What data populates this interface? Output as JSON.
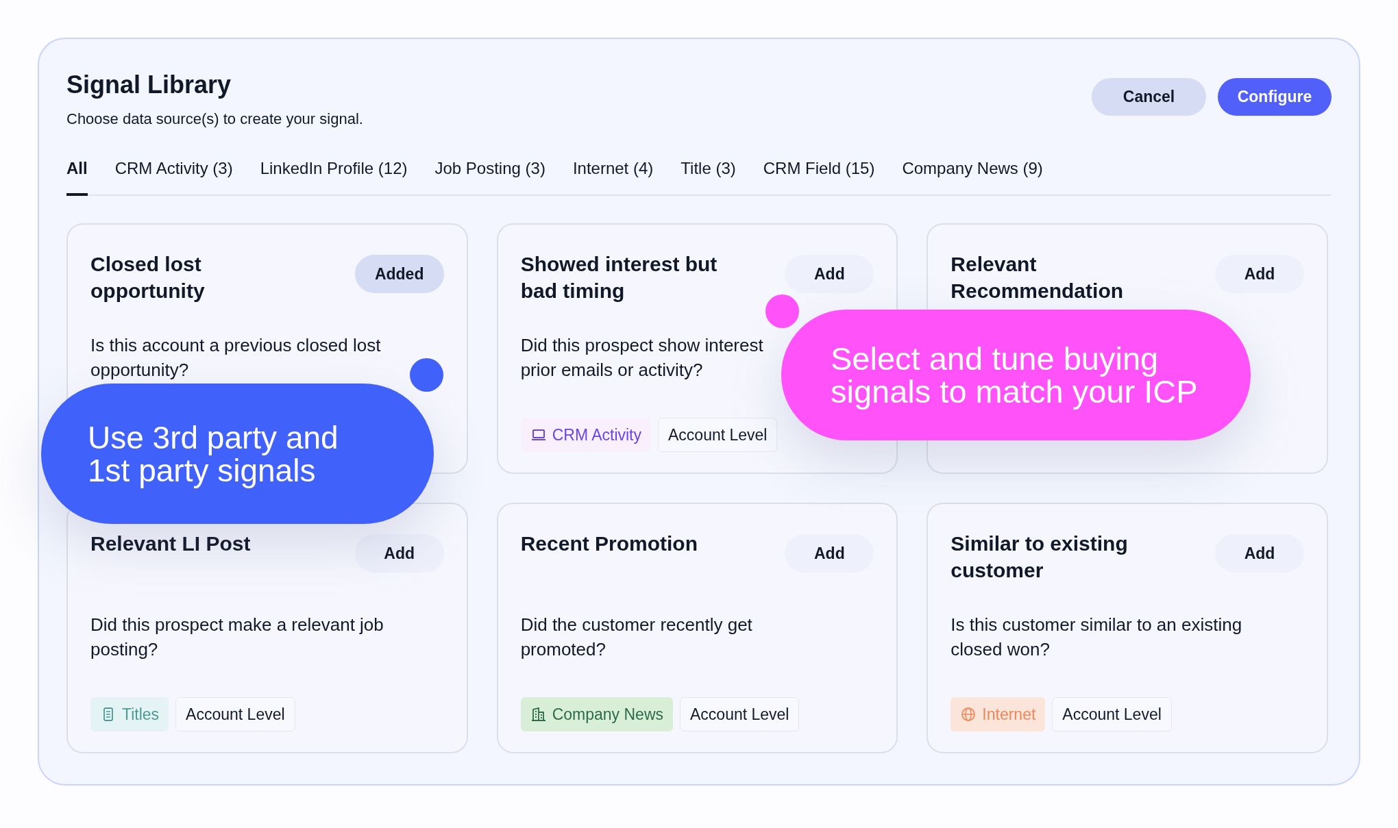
{
  "header": {
    "title": "Signal Library",
    "subtitle": "Choose data source(s) to create your signal."
  },
  "buttons": [
    {
      "label": "Cancel",
      "kind": "secondary"
    },
    {
      "label": "Configure",
      "kind": "primary"
    }
  ],
  "tabs": [
    {
      "label": "All",
      "selected": true
    },
    {
      "label": "CRM Activity (3)",
      "selected": false
    },
    {
      "label": "LinkedIn Profile (12)",
      "selected": false
    },
    {
      "label": "Job Posting (3)",
      "selected": false
    },
    {
      "label": "Internet (4)",
      "selected": false
    },
    {
      "label": "Title (3)",
      "selected": false
    },
    {
      "label": "CRM Field (15)",
      "selected": false
    },
    {
      "label": "Company News (9)",
      "selected": false
    }
  ],
  "cards": [
    {
      "title": "Closed lost opportunity",
      "action": "Added",
      "added": true,
      "description_lines": [
        "Is this account a previous closed lost",
        "opportunity?"
      ]
    },
    {
      "title": "Showed interest but bad timing",
      "action": "Add",
      "added": false,
      "description_lines": [
        "Did this prospect show interest",
        "prior emails or activity?"
      ],
      "tags": [
        {
          "label": "CRM Activity",
          "kind": "crm"
        },
        {
          "label": "Account Level",
          "kind": "level"
        }
      ]
    },
    {
      "title": "Relevant Recommendation",
      "action": "Add",
      "added": false
    },
    {
      "title": "Relevant LI Post",
      "action": "Add",
      "added": false,
      "description_lines": [
        "Did this prospect make a relevant job",
        "posting?"
      ],
      "tags": [
        {
          "label": "Titles",
          "kind": "titles"
        },
        {
          "label": "Account Level",
          "kind": "level"
        }
      ]
    },
    {
      "title": "Recent Promotion",
      "action": "Add",
      "added": false,
      "description_lines": [
        "Did the customer recently get",
        "promoted?"
      ],
      "tags": [
        {
          "label": "Company News",
          "kind": "news"
        },
        {
          "label": "Account Level",
          "kind": "level"
        }
      ]
    },
    {
      "title": "Similar to existing customer",
      "action": "Add",
      "added": false,
      "description_lines": [
        "Is this customer similar to an existing",
        "closed won?"
      ],
      "tags": [
        {
          "label": "Internet",
          "kind": "internet"
        },
        {
          "label": "Account Level",
          "kind": "level"
        }
      ]
    }
  ],
  "callouts": [
    {
      "text": "Use 3rd party and 1st party signals",
      "kind": "blue"
    },
    {
      "text": "Select and tune buying signals to match your ICP",
      "kind": "pink"
    }
  ]
}
